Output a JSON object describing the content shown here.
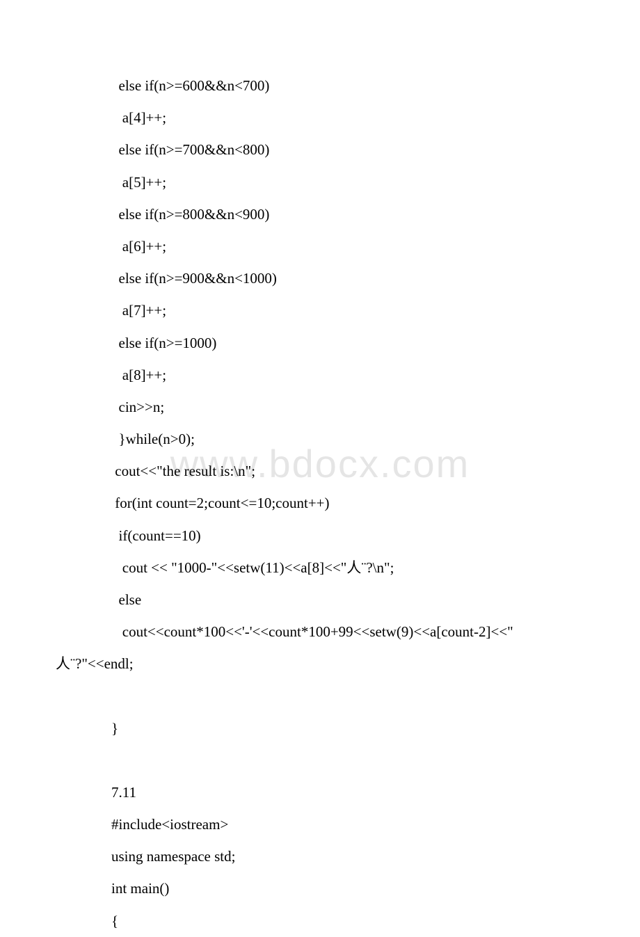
{
  "watermark": "www.bdocx.com",
  "lines": {
    "l0": "  else if(n>=600&&n<700)",
    "l1": "   a[4]++;",
    "l2": "  else if(n>=700&&n<800)",
    "l3": "   a[5]++;",
    "l4": "  else if(n>=800&&n<900)",
    "l5": "   a[6]++;",
    "l6": "  else if(n>=900&&n<1000)",
    "l7": "   a[7]++;",
    "l8": "  else if(n>=1000)",
    "l9": "   a[8]++;",
    "l10": "  cin>>n;",
    "l11": "  }while(n>0);",
    "l12": " cout<<\"the result is:\\n\";",
    "l13": " for(int count=2;count<=10;count++)",
    "l14": "  if(count==10)",
    "l15": "   cout << \"1000-\"<<setw(11)<<a[8]<<\"人¨?\\n\";",
    "l16": "  else",
    "l17": "   cout<<count*100<<'-'<<count*100+99<<setw(9)<<a[count-2]<<\"",
    "l18": "人¨?\"<<endl;",
    "l19": "}",
    "l20": "7.11",
    "l21": "#include<iostream>",
    "l22": "using namespace std;",
    "l23": "int main()",
    "l24": "{"
  }
}
